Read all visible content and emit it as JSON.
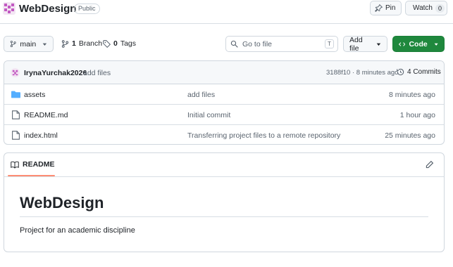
{
  "repo": {
    "name": "WebDesign",
    "visibility": "Public",
    "pin_label": "Pin",
    "watch_label": "Watch",
    "watch_count": "0"
  },
  "branch_bar": {
    "branch": "main",
    "branch_count": "1",
    "branch_word": "Branch",
    "tag_count": "0",
    "tag_word": "Tags",
    "search_placeholder": "Go to file",
    "search_shortcut": "T",
    "add_file_label": "Add file",
    "code_label": "Code"
  },
  "last_commit": {
    "author": "IrynaYurchak2026",
    "message": "add files",
    "hash_time": "3188f10 · 8 minutes ago",
    "commits_label": "4 Commits"
  },
  "files": [
    {
      "name": "assets",
      "type": "folder",
      "commit": "add files",
      "time": "8 minutes ago"
    },
    {
      "name": "README.md",
      "type": "file",
      "commit": "Initial commit",
      "time": "1 hour ago"
    },
    {
      "name": "index.html",
      "type": "file",
      "commit": "Transferring project files to a remote repository",
      "time": "25 minutes ago"
    }
  ],
  "readme": {
    "tab_label": "README",
    "heading": "WebDesign",
    "body": "Project for an academic discipline"
  },
  "colors": {
    "code_button": "#1f883d",
    "folder_icon": "#54aeff",
    "readme_tab_accent": "#fd8c73"
  },
  "icons": [
    "repo-avatar-icon",
    "pin-icon",
    "eye-icon",
    "branch-icon",
    "tag-icon",
    "search-icon",
    "caret-down-icon",
    "code-icon",
    "history-icon",
    "folder-icon",
    "file-icon",
    "book-icon",
    "pencil-icon"
  ]
}
